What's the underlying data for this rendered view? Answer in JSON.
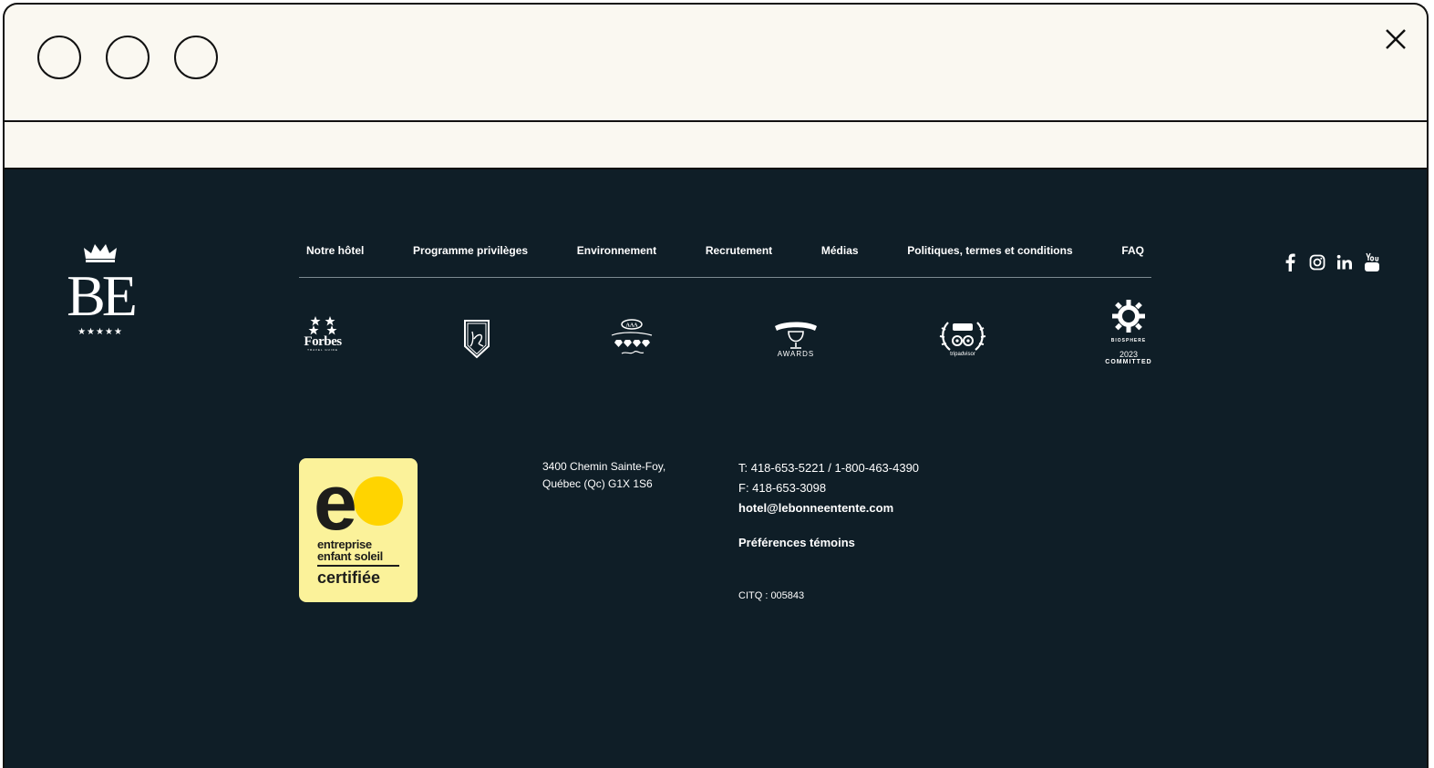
{
  "browser": {
    "close_icon": "close-icon"
  },
  "footer": {
    "logo": {
      "letters": "BE",
      "stars": "★★★★★"
    },
    "nav": [
      {
        "label": "Notre hôtel"
      },
      {
        "label": "Programme privilèges"
      },
      {
        "label": "Environnement"
      },
      {
        "label": "Recrutement"
      },
      {
        "label": "Médias"
      },
      {
        "label": "Politiques, termes et conditions"
      },
      {
        "label": "FAQ"
      }
    ],
    "social": [
      {
        "icon": "facebook-icon",
        "glyph": "f"
      },
      {
        "icon": "instagram-icon",
        "glyph": "◎"
      },
      {
        "icon": "linkedin-icon",
        "glyph": "in"
      },
      {
        "icon": "youtube-icon",
        "glyph": "You Tube"
      }
    ],
    "awards": {
      "forbes": "Forbes",
      "forbes_sub": "TRAVEL GUIDE",
      "awards_label": "AWARDS",
      "tripadvisor": "tripadvisor",
      "tripadvisor_choice": "CHOICE",
      "biosphere": "BIOSPHERE",
      "biosphere_year": "2023",
      "biosphere_committed": "COMMITTED"
    },
    "badge": {
      "letter": "e",
      "line1": "entreprise",
      "line2": "enfant soleil",
      "line3": "certifiée"
    },
    "address": {
      "line1": "3400 Chemin Sainte-Foy,",
      "line2": "Québec (Qc) G1X 1S6"
    },
    "contact": {
      "phone": "T: 418-653-5221 / 1-800-463-4390",
      "fax": "F: 418-653-3098",
      "email": "hotel@lebonneentente.com"
    },
    "cookies": "Préférences témoins",
    "citq": "CITQ : 005843"
  }
}
